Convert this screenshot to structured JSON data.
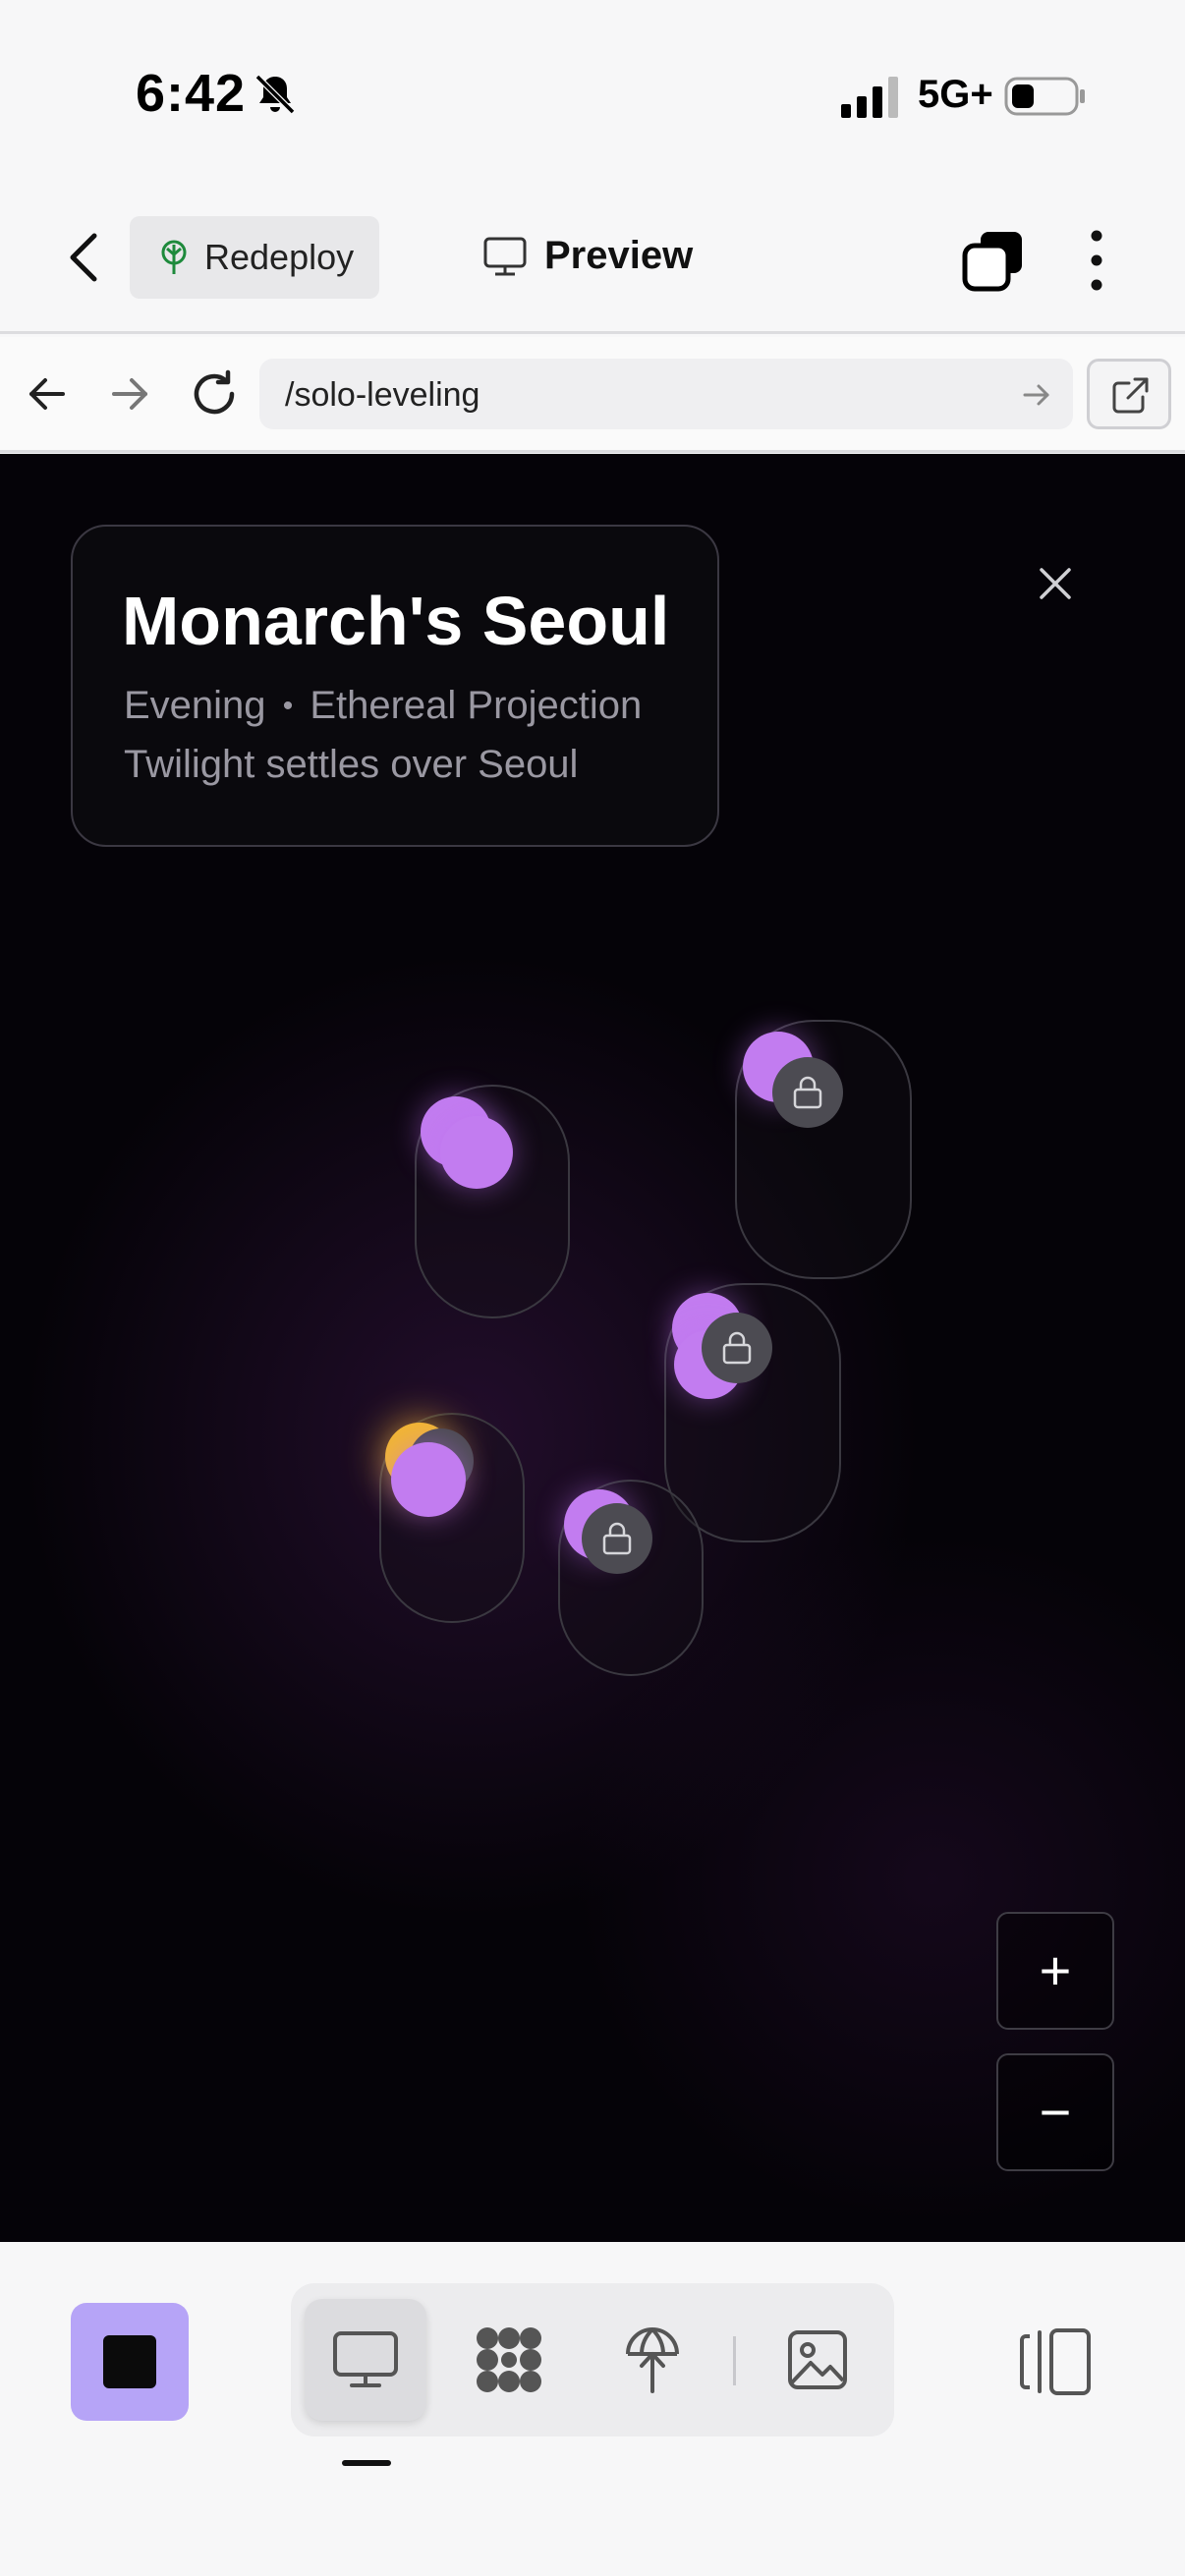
{
  "status_bar": {
    "time": "6:42",
    "network": "5G+",
    "icons": [
      "bell-slash-icon",
      "cellular-signal-icon",
      "battery-icon"
    ]
  },
  "header": {
    "back_icon": "chevron-left-icon",
    "redeploy_label": "Redeploy",
    "redeploy_icon": "tree-icon",
    "redeploy_icon_color": "#1e8a3c",
    "preview_label": "Preview",
    "preview_icon": "monitor-icon",
    "stack_icon": "stacked-squares-icon",
    "menu_icon": "kebab-menu-icon"
  },
  "browser": {
    "url": "/solo-leveling",
    "icons": [
      "arrow-left-icon",
      "arrow-right-icon",
      "reload-icon",
      "arrow-go-icon",
      "external-link-icon"
    ]
  },
  "preview": {
    "card": {
      "title": "Monarch's Seoul",
      "time_of_day": "Evening",
      "separator": "•",
      "mode": "Ethereal Projection",
      "subtitle": "Twilight settles over Seoul"
    },
    "close_icon": "close-icon",
    "zoom_in_label": "+",
    "zoom_out_label": "−",
    "colors": {
      "background": "#050308",
      "orb": "#c27cf0",
      "orb_gold": "#f2b632",
      "lock_badge": "#4c4b52"
    }
  },
  "toolbar": {
    "app_color": "#b6a4f7",
    "modes": [
      "monitor-icon",
      "network-graph-icon",
      "deploy-globe-icon",
      "image-icon"
    ],
    "active_mode": "monitor-icon",
    "panel_icon": "side-panel-icon"
  }
}
